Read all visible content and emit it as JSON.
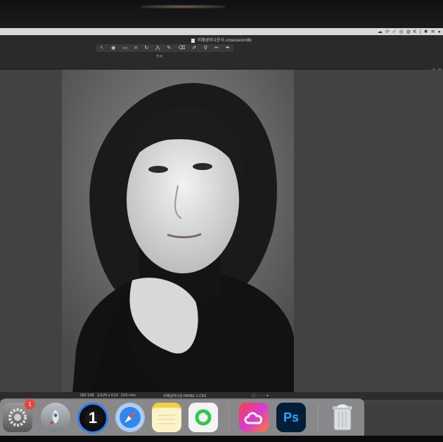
{
  "window": {
    "title": "이혜성마나운서.cosessiondb"
  },
  "toolbar": {
    "tools": [
      {
        "name": "cursor-tool",
        "glyph": "↖"
      },
      {
        "name": "camera-tool",
        "glyph": "◉"
      },
      {
        "name": "select-tool",
        "glyph": "▭"
      },
      {
        "name": "crop-tool",
        "glyph": "⌗"
      },
      {
        "name": "rotate-tool",
        "glyph": "↻"
      },
      {
        "name": "keystone-tool",
        "glyph": "⋀"
      },
      {
        "name": "brush-tool",
        "glyph": "✎"
      },
      {
        "name": "eraser-tool",
        "glyph": "⌫"
      },
      {
        "name": "gradient-tool",
        "glyph": "✐"
      },
      {
        "name": "picker-tool",
        "glyph": "⚲"
      },
      {
        "name": "heal-tool",
        "glyph": "✏"
      },
      {
        "name": "annotate-tool",
        "glyph": "✒"
      }
    ],
    "active_label": "커서"
  },
  "right_panel": {
    "label": "맞춤"
  },
  "info": {
    "iso": "ISO 100",
    "shutter": "1/125 s",
    "aperture": "f/13",
    "focal": "115 mm",
    "filename": "이혜성마나운서0082 1.CR2"
  },
  "dock": {
    "apps": [
      {
        "name": "system-preferences",
        "badge": "1"
      },
      {
        "name": "launchpad"
      },
      {
        "name": "capture-one",
        "label": "1"
      },
      {
        "name": "safari"
      },
      {
        "name": "notes"
      },
      {
        "name": "facetime"
      },
      {
        "name": "creative-cloud"
      },
      {
        "name": "photoshop",
        "label": "Ps"
      },
      {
        "name": "trash"
      }
    ]
  },
  "colors": {
    "accent": "#e9922f",
    "photoshop": "#31a8ff",
    "badge": "#e9453a"
  }
}
